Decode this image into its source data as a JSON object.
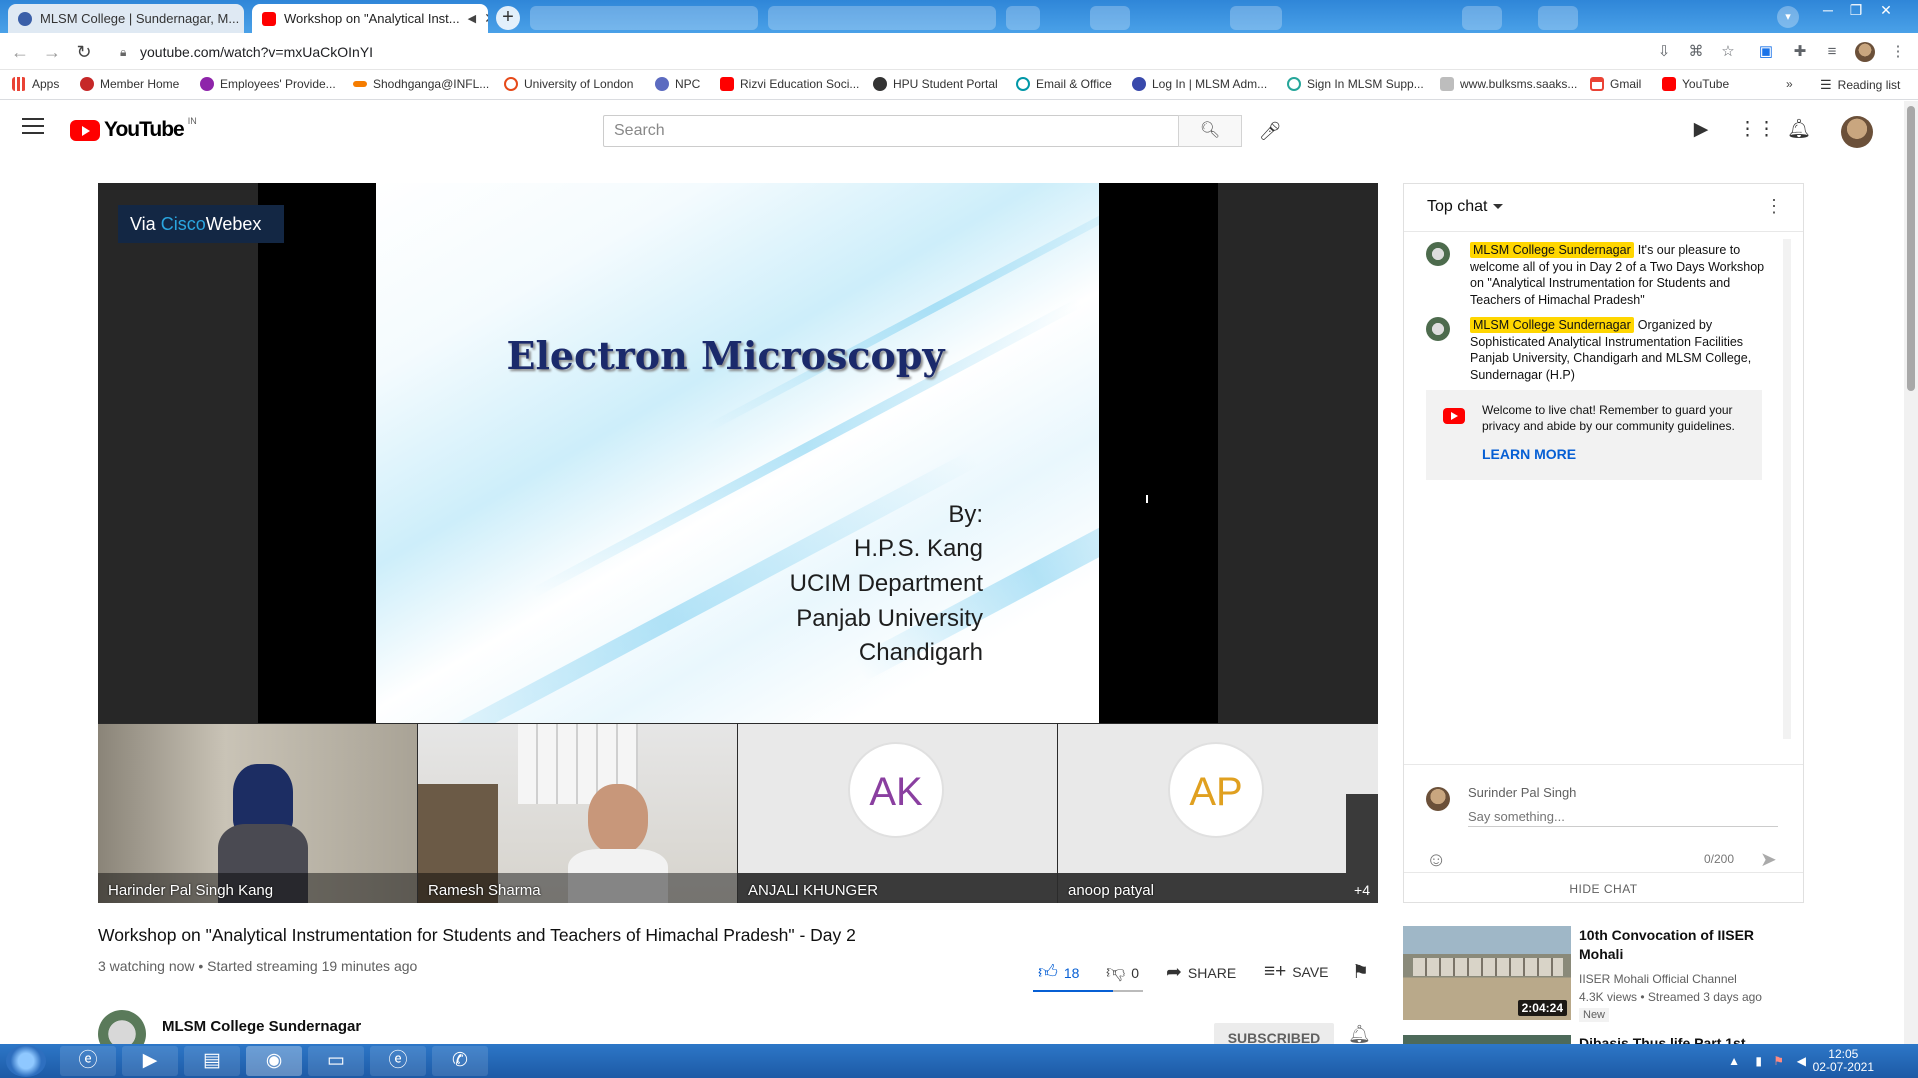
{
  "browser": {
    "tabs": [
      {
        "title": "MLSM College | Sundernagar, M...",
        "state": "inactive"
      },
      {
        "title": "Workshop on \"Analytical Inst...",
        "state": "active"
      }
    ],
    "url": "youtube.com/watch?v=mxUaCkOInYI",
    "bookmarks": [
      "Apps",
      "Member Home",
      "Employees' Provide...",
      "Shodhganga@INFL...",
      "University of London",
      "NPC",
      "Rizvi Education Soci...",
      "HPU Student Portal",
      "Email & Office",
      "Log In | MLSM Adm...",
      "Sign In MLSM Supp...",
      "www.bulksms.saaks...",
      "Gmail",
      "YouTube"
    ],
    "reading_list": "Reading list"
  },
  "youtube": {
    "logo_text": "YouTube",
    "country": "IN",
    "search_placeholder": "Search"
  },
  "video": {
    "via_prefix": "Via ",
    "via_cisco": "Cisco",
    "via_webex": "Webex",
    "slide_title": "Electron Microscopy",
    "slide_lines": [
      "By:",
      "H.P.S. Kang",
      "UCIM Department",
      "Panjab University",
      "Chandigarh"
    ],
    "participants": [
      {
        "name": "Harinder Pal Singh Kang",
        "initials": ""
      },
      {
        "name": "Ramesh Sharma",
        "initials": ""
      },
      {
        "name": "ANJALI KHUNGER",
        "initials": "AK"
      },
      {
        "name": "anoop patyal",
        "initials": "AP"
      }
    ],
    "more_participants": "+4",
    "title": "Workshop on \"Analytical Instrumentation for Students and Teachers of Himachal Pradesh\" - Day 2",
    "meta": "3 watching now • Started streaming 19 minutes ago",
    "likes": "18",
    "dislikes": "0",
    "share_label": "SHARE",
    "save_label": "SAVE",
    "channel_name": "MLSM College Sundernagar",
    "subscribed_label": "SUBSCRIBED"
  },
  "chat": {
    "mode_label": "Top chat",
    "messages": [
      {
        "author": "MLSM College Sundernagar",
        "text": "It's our pleasure to welcome all of you in Day 2 of a Two Days Workshop on \"Analytical Instrumentation for Students and Teachers of Himachal Pradesh\""
      },
      {
        "author": "MLSM College Sundernagar",
        "text": "Organized by Sophisticated Analytical Instrumentation Facilities Panjab University, Chandigarh and MLSM College, Sundernagar (H.P)"
      }
    ],
    "welcome_text": "Welcome to live chat! Remember to guard your privacy and abide by our community guidelines.",
    "learn_more": "LEARN MORE",
    "user_name": "Surinder Pal Singh",
    "input_placeholder": "Say something...",
    "char_count": "0/200",
    "hide_chat": "HIDE CHAT"
  },
  "recommendations": [
    {
      "title": "10th Convocation of IISER Mohali",
      "channel": "IISER Mohali Official Channel",
      "meta": "4.3K views • Streamed 3 days ago",
      "badge": "New",
      "duration": "2:04:24"
    },
    {
      "title": "Dibasis Thus life Part 1st "
    }
  ],
  "taskbar": {
    "time": "12:05",
    "date": "02-07-2021"
  },
  "colors": {
    "youtube_red": "#ff0000",
    "link_blue": "#065fd4",
    "author_highlight": "#ffd600",
    "taskbar_blue": "#1d5aa6"
  }
}
